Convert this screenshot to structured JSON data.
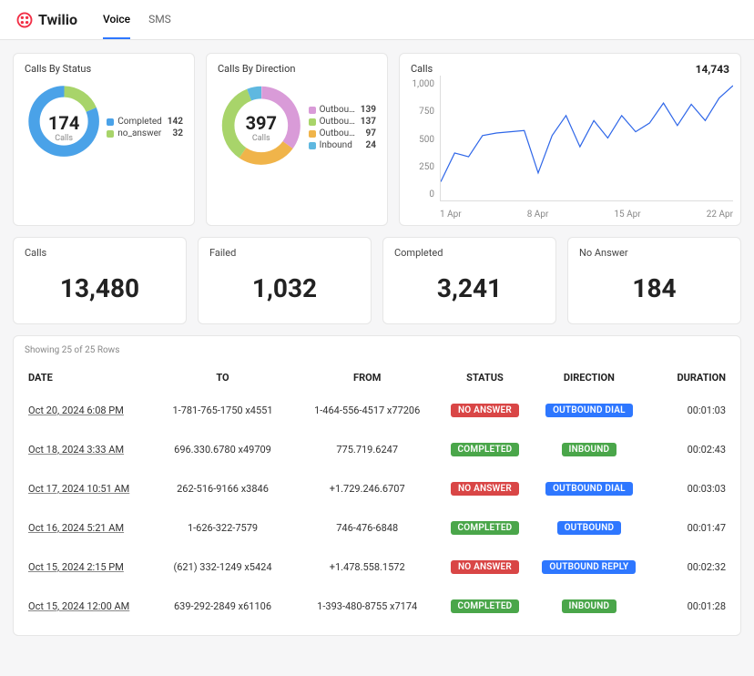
{
  "header": {
    "brand": "Twilio",
    "tabs": [
      {
        "label": "Voice",
        "active": true
      },
      {
        "label": "SMS",
        "active": false
      }
    ]
  },
  "donut_status": {
    "title": "Calls By Status",
    "total": "174",
    "total_label": "Calls",
    "legend": [
      {
        "label": "Completed",
        "value": "142",
        "color": "#4aa2e8"
      },
      {
        "label": "no_answer",
        "value": "32",
        "color": "#a8d46a"
      }
    ]
  },
  "donut_direction": {
    "title": "Calls By Direction",
    "total": "397",
    "total_label": "Calls",
    "legend": [
      {
        "label": "Outbou…",
        "value": "139",
        "color": "#d99bd8"
      },
      {
        "label": "Outbou…",
        "value": "137",
        "color": "#a8d46a"
      },
      {
        "label": "Outbou…",
        "value": "97",
        "color": "#f0b44a"
      },
      {
        "label": "Inbound",
        "value": "24",
        "color": "#5fb8e0"
      }
    ]
  },
  "line_chart": {
    "title": "Calls",
    "total": "14,743",
    "y_ticks": [
      "0",
      "250",
      "500",
      "750",
      "1,000"
    ],
    "x_ticks": [
      "1 Apr",
      "8 Apr",
      "15 Apr",
      "22 Apr"
    ]
  },
  "chart_data": [
    {
      "type": "donut",
      "title": "Calls By Status",
      "total": 174,
      "series": [
        {
          "name": "Completed",
          "value": 142
        },
        {
          "name": "no_answer",
          "value": 32
        }
      ]
    },
    {
      "type": "donut",
      "title": "Calls By Direction",
      "total": 397,
      "series": [
        {
          "name": "Outbound (A)",
          "value": 139
        },
        {
          "name": "Outbound (B)",
          "value": 137
        },
        {
          "name": "Outbound (C)",
          "value": 97
        },
        {
          "name": "Inbound",
          "value": 24
        }
      ]
    },
    {
      "type": "line",
      "title": "Calls",
      "xlabel": "",
      "ylabel": "",
      "ylim": [
        0,
        1000
      ],
      "x": [
        "1 Apr",
        "2 Apr",
        "3 Apr",
        "4 Apr",
        "5 Apr",
        "6 Apr",
        "7 Apr",
        "8 Apr",
        "9 Apr",
        "10 Apr",
        "11 Apr",
        "12 Apr",
        "13 Apr",
        "14 Apr",
        "15 Apr",
        "16 Apr",
        "17 Apr",
        "18 Apr",
        "19 Apr",
        "20 Apr",
        "21 Apr",
        "22 Apr"
      ],
      "series": [
        {
          "name": "Calls",
          "values": [
            150,
            380,
            350,
            520,
            540,
            550,
            560,
            220,
            520,
            680,
            430,
            640,
            500,
            680,
            550,
            620,
            780,
            600,
            770,
            640,
            820,
            920
          ]
        }
      ]
    }
  ],
  "metrics": [
    {
      "label": "Calls",
      "value": "13,480"
    },
    {
      "label": "Failed",
      "value": "1,032"
    },
    {
      "label": "Completed",
      "value": "3,241"
    },
    {
      "label": "No Answer",
      "value": "184"
    }
  ],
  "table": {
    "rows_info": "Showing 25 of 25 Rows",
    "columns": [
      "DATE",
      "TO",
      "FROM",
      "STATUS",
      "DIRECTION",
      "DURATION"
    ],
    "rows": [
      {
        "date": "Oct 20, 2024 6:08 PM",
        "to": "1-781-765-1750 x4551",
        "from": "1-464-556-4517 x77206",
        "status": "NO ANSWER",
        "status_class": "b-red",
        "direction": "OUTBOUND DIAL",
        "dir_class": "b-blue",
        "duration": "00:01:03"
      },
      {
        "date": "Oct 18, 2024 3:33 AM",
        "to": "696.330.6780 x49709",
        "from": "775.719.6247",
        "status": "COMPLETED",
        "status_class": "b-green",
        "direction": "INBOUND",
        "dir_class": "b-green",
        "duration": "00:02:43"
      },
      {
        "date": "Oct 17, 2024 10:51 AM",
        "to": "262-516-9166 x3846",
        "from": "+1.729.246.6707",
        "status": "NO ANSWER",
        "status_class": "b-red",
        "direction": "OUTBOUND DIAL",
        "dir_class": "b-blue",
        "duration": "00:03:03"
      },
      {
        "date": "Oct 16, 2024 5:21 AM",
        "to": "1-626-322-7579",
        "from": "746-476-6848",
        "status": "COMPLETED",
        "status_class": "b-green",
        "direction": "OUTBOUND",
        "dir_class": "b-blue",
        "duration": "00:01:47"
      },
      {
        "date": "Oct 15, 2024 2:15 PM",
        "to": "(621) 332-1249 x5424",
        "from": "+1.478.558.1572",
        "status": "NO ANSWER",
        "status_class": "b-red",
        "direction": "OUTBOUND REPLY",
        "dir_class": "b-blue",
        "duration": "00:02:32"
      },
      {
        "date": "Oct 15, 2024 12:00 AM",
        "to": "639-292-2849 x61106",
        "from": "1-393-480-8755 x7174",
        "status": "COMPLETED",
        "status_class": "b-green",
        "direction": "INBOUND",
        "dir_class": "b-green",
        "duration": "00:01:28"
      }
    ]
  }
}
